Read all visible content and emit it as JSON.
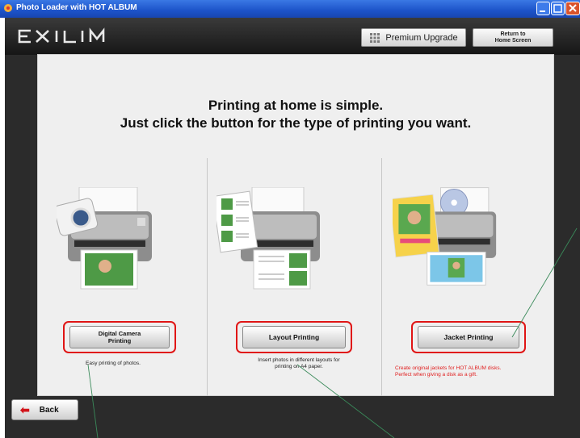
{
  "window": {
    "title": "Photo Loader with HOT ALBUM"
  },
  "header": {
    "logo": "EXILIM",
    "premium_label": "Premium Upgrade",
    "return_label": "Return to\nHome Screen"
  },
  "content": {
    "heading_line1": "Printing at home is simple.",
    "heading_line2": "Just click the button for the type of printing you want."
  },
  "options": [
    {
      "button": "Digital Camera\nPrinting",
      "desc": "Easy printing of photos."
    },
    {
      "button": "Layout Printing",
      "desc": "Insert photos in different layouts for\nprinting on A4 paper."
    },
    {
      "button": "Jacket Printing",
      "desc": "Create original jackets for HOT ALBUM disks.\nPerfect when giving a disk as a gift."
    }
  ],
  "footer": {
    "back_label": "Back"
  },
  "colors": {
    "highlight": "#e01515",
    "titlebar": "#1c53c9",
    "back_arrow": "#d2141a"
  }
}
